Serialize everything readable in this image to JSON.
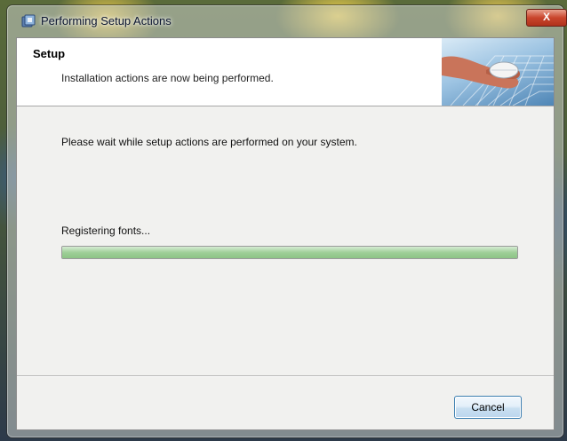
{
  "window": {
    "title": "Performing Setup Actions",
    "close_label": "X"
  },
  "header": {
    "title": "Setup",
    "subtitle": "Installation actions are now being performed."
  },
  "main": {
    "message": "Please wait while setup actions are performed on your system.",
    "status": "Registering fonts...",
    "progress_fraction": 1.0
  },
  "footer": {
    "cancel_label": "Cancel"
  },
  "colors": {
    "accent": "#3c7fb1",
    "close_red": "#c9452c",
    "progress_green": "#9fcf98"
  },
  "icons": {
    "title_icon": "setup-installer-icon",
    "header_image": "hand-on-keyboard-graphic"
  }
}
